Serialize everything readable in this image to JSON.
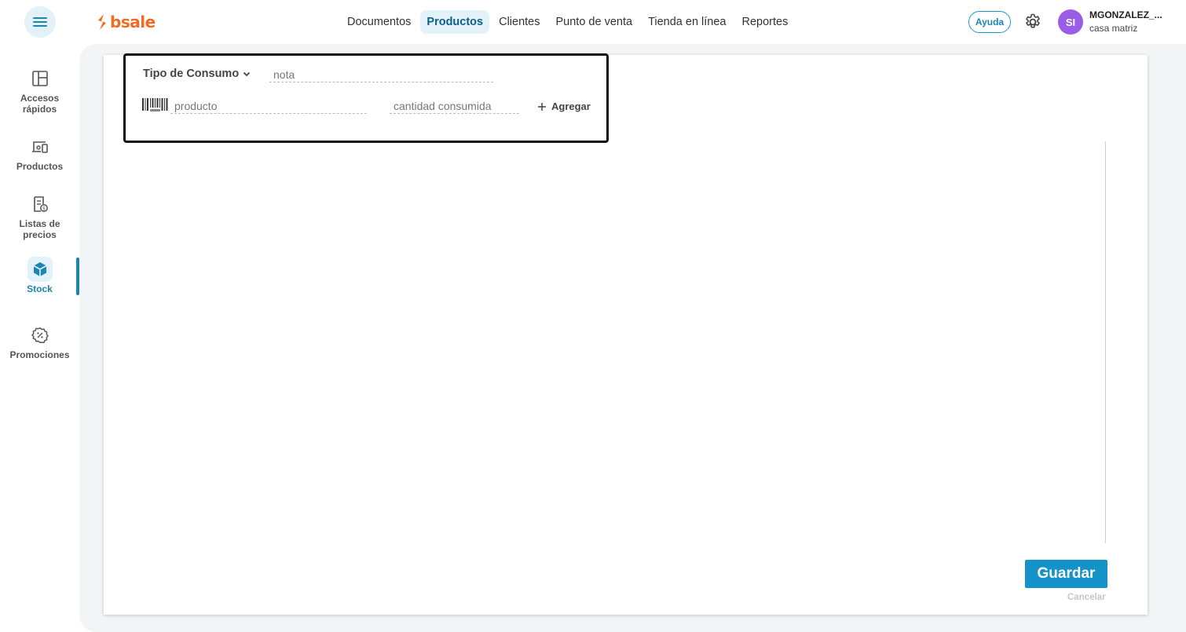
{
  "header": {
    "logo_text": "bsale",
    "nav": [
      {
        "label": "Documentos",
        "active": false
      },
      {
        "label": "Productos",
        "active": true
      },
      {
        "label": "Clientes",
        "active": false
      },
      {
        "label": "Punto de venta",
        "active": false
      },
      {
        "label": "Tienda en línea",
        "active": false
      },
      {
        "label": "Reportes",
        "active": false
      }
    ],
    "help_label": "Ayuda",
    "user": {
      "initials": "SI",
      "name": "MGONZALEZ_...",
      "branch": "casa matriz"
    },
    "icons": {
      "menu": "menu-icon",
      "settings": "gear-icon"
    }
  },
  "sidebar": {
    "items": [
      {
        "label": "Accesos rápidos",
        "icon": "layout-icon",
        "active": false
      },
      {
        "label": "Productos",
        "icon": "devices-icon",
        "active": false
      },
      {
        "label": "Listas de precios",
        "icon": "price-list-icon",
        "active": false
      },
      {
        "label": "Stock",
        "icon": "box-icon",
        "active": true
      },
      {
        "label": "Promociones",
        "icon": "discount-icon",
        "active": false
      }
    ]
  },
  "form": {
    "tipo_label": "Tipo de Consumo",
    "nota_placeholder": "nota",
    "producto_placeholder": "producto",
    "cantidad_placeholder": "cantidad consumida",
    "agregar_label": "Agregar"
  },
  "actions": {
    "save_label": "Guardar",
    "cancel_label": "Cancelar"
  },
  "colors": {
    "brand": "#f26b21",
    "accent": "#1593c8",
    "active_bg": "#e3f2f8",
    "avatar": "#9b5de5"
  }
}
